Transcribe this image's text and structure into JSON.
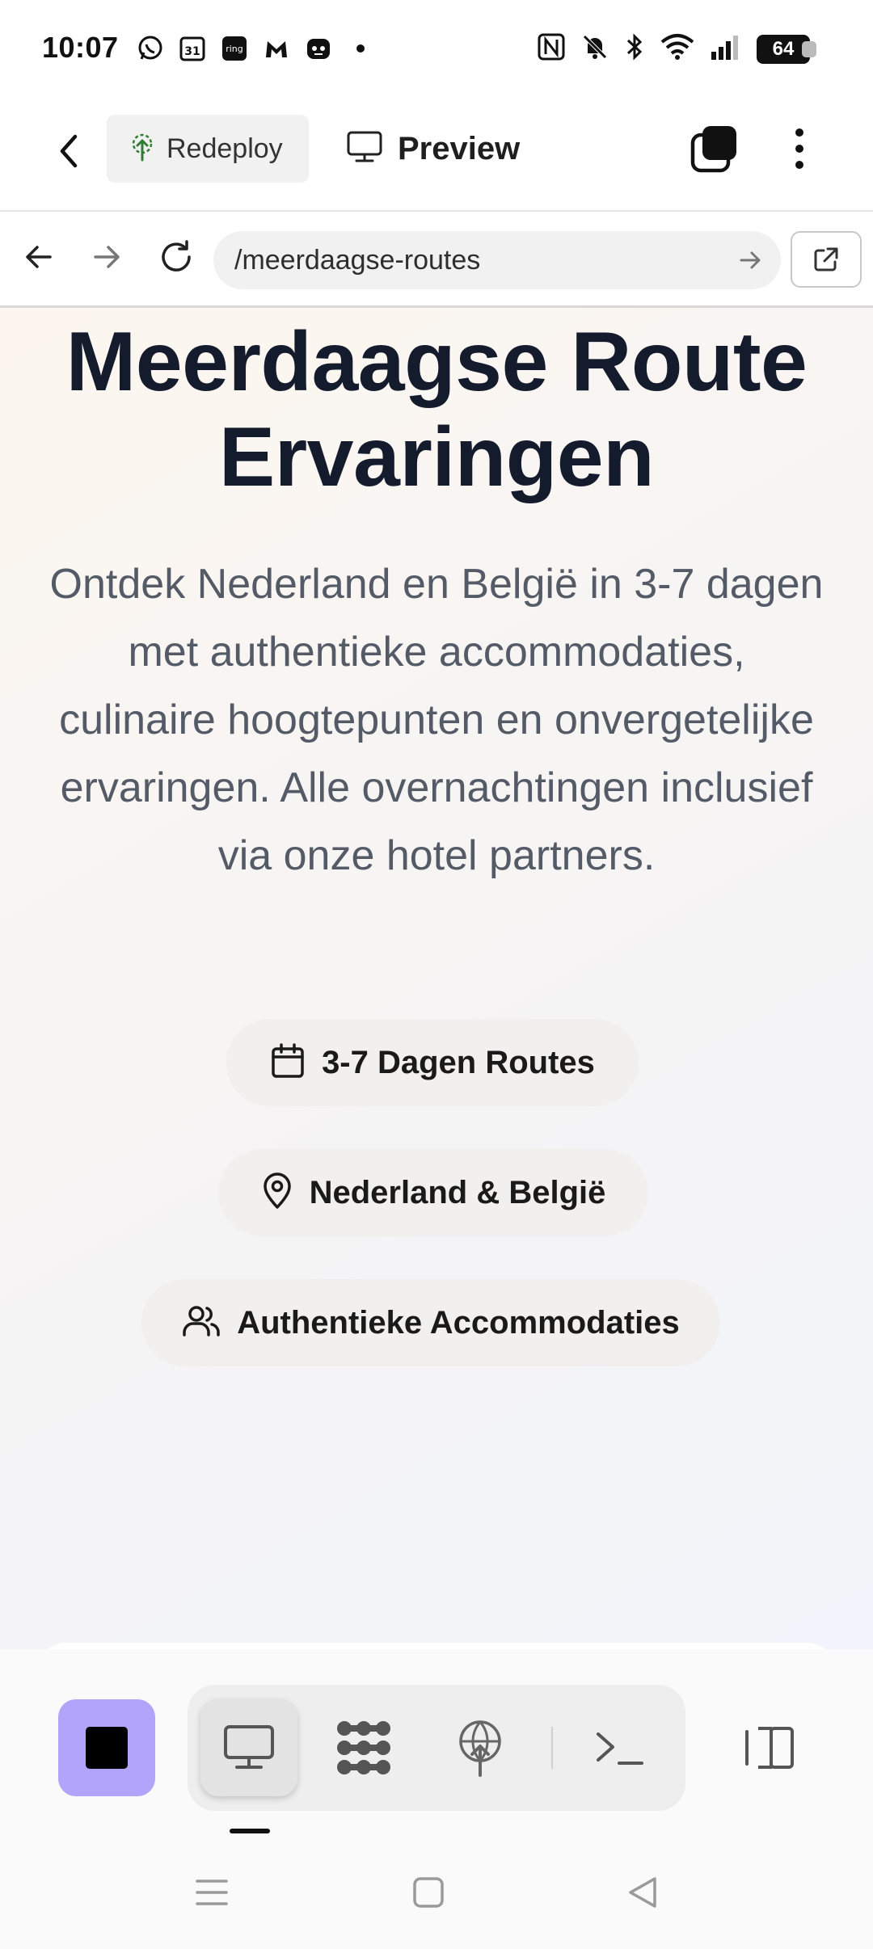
{
  "status_bar": {
    "time": "10:07",
    "battery": "64",
    "left_icons": [
      "whatsapp-icon",
      "calendar-31-icon",
      "ring-icon",
      "malwarebytes-icon",
      "bot-icon",
      "dot-icon"
    ],
    "right_icons": [
      "nfc-icon",
      "bell-off-icon",
      "bluetooth-icon",
      "wifi-icon",
      "signal-icon",
      "battery-icon"
    ]
  },
  "toolbar": {
    "redeploy_label": "Redeploy",
    "preview_label": "Preview",
    "accent_color": "#2e7d32"
  },
  "url_bar": {
    "url": "/meerdaagse-routes"
  },
  "hero": {
    "title": "Meerdaagse Route Ervaringen",
    "subtitle": "Ontdek Nederland en België in 3-7 dagen met authentieke accommodaties, culinaire hoogtepunten en onvergetelijke ervaringen. Alle overnachtingen inclusief via onze hotel partners.",
    "pills": [
      {
        "icon": "calendar-icon",
        "label": "3-7 Dagen Routes"
      },
      {
        "icon": "map-pin-icon",
        "label": "Nederland & België"
      },
      {
        "icon": "users-icon",
        "label": "Authentieke Accommodaties"
      }
    ]
  },
  "bottom_bar": {
    "stop_color": "#b2a3fb",
    "modes": [
      "desktop-icon",
      "apps-icon",
      "deploy-icon",
      "terminal-icon"
    ],
    "active_mode": "desktop-icon"
  }
}
